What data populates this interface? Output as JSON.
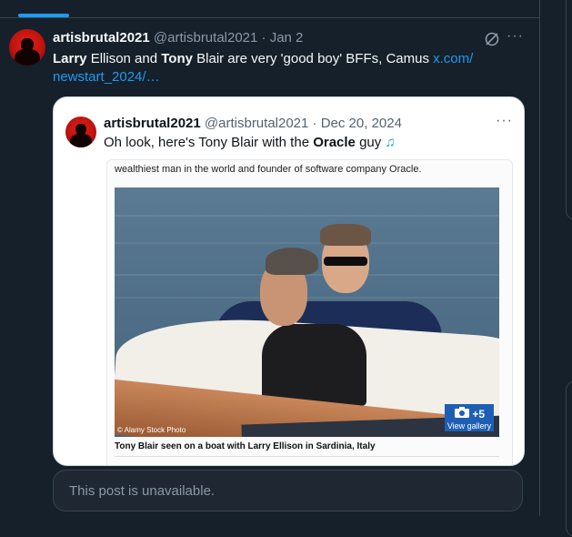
{
  "post": {
    "display_name": "artisbrutal2021",
    "handle": "@artisbrutal2021",
    "date": "· Jan 2",
    "text_parts": {
      "larry": "Larry",
      "t1": " Ellison and ",
      "tony": "Tony",
      "t2": " Blair are very 'good boy' BFFs, Camus ",
      "link1": "x.com/",
      "link2": "newstart_2024/…"
    },
    "more_label": "···"
  },
  "quote": {
    "display_name": "artisbrutal2021",
    "handle": "@artisbrutal2021",
    "date": "· Dec 20, 2024",
    "text_before": "Oh look, here's Tony Blair with the ",
    "text_bold": "Oracle",
    "text_after": " guy ",
    "emoji": "♫",
    "more_label": "···",
    "article": {
      "top_text": "wealthiest man in the world and founder of software company Oracle.",
      "photo_credit": "© Alamy Stock Photo",
      "gallery_count": "+5",
      "gallery_label": "View gallery",
      "caption": "Tony Blair seen on a boat with Larry Ellison in Sardinia, Italy"
    }
  },
  "unavailable_text": "This post is unavailable.",
  "colors": {
    "background": "#15202b",
    "accent": "#1d9bf0",
    "muted": "#8b98a5",
    "border": "#38444d"
  }
}
